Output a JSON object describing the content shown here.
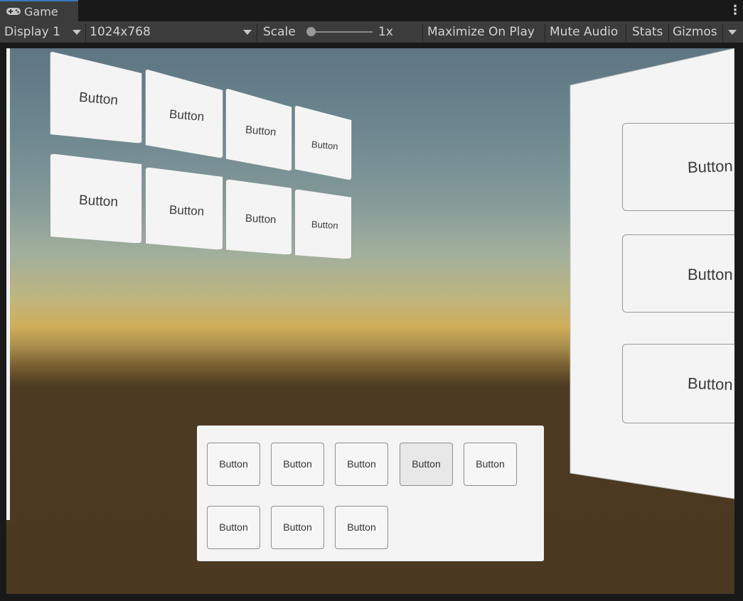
{
  "tab": {
    "label": "Game",
    "icon": "gamepad-icon"
  },
  "toolbar": {
    "display": "Display 1",
    "resolution": "1024x768",
    "scale_label": "Scale",
    "scale_value": "1x",
    "maximize": "Maximize On Play",
    "mute": "Mute Audio",
    "stats": "Stats",
    "gizmos": "Gizmos"
  },
  "scene": {
    "wall_buttons": [
      "Button",
      "Button",
      "Button",
      "Button",
      "Button",
      "Button",
      "Button",
      "Button"
    ],
    "side_buttons": [
      "Button",
      "Button",
      "Button"
    ],
    "panel_buttons": [
      "Button",
      "Button",
      "Button",
      "Button",
      "Button",
      "Button",
      "Button",
      "Button"
    ]
  },
  "colors": {
    "accent": "#3a79bb",
    "toolbar": "#3c3c3c",
    "ground": "#4a3820",
    "panel": "#f4f4f4"
  }
}
